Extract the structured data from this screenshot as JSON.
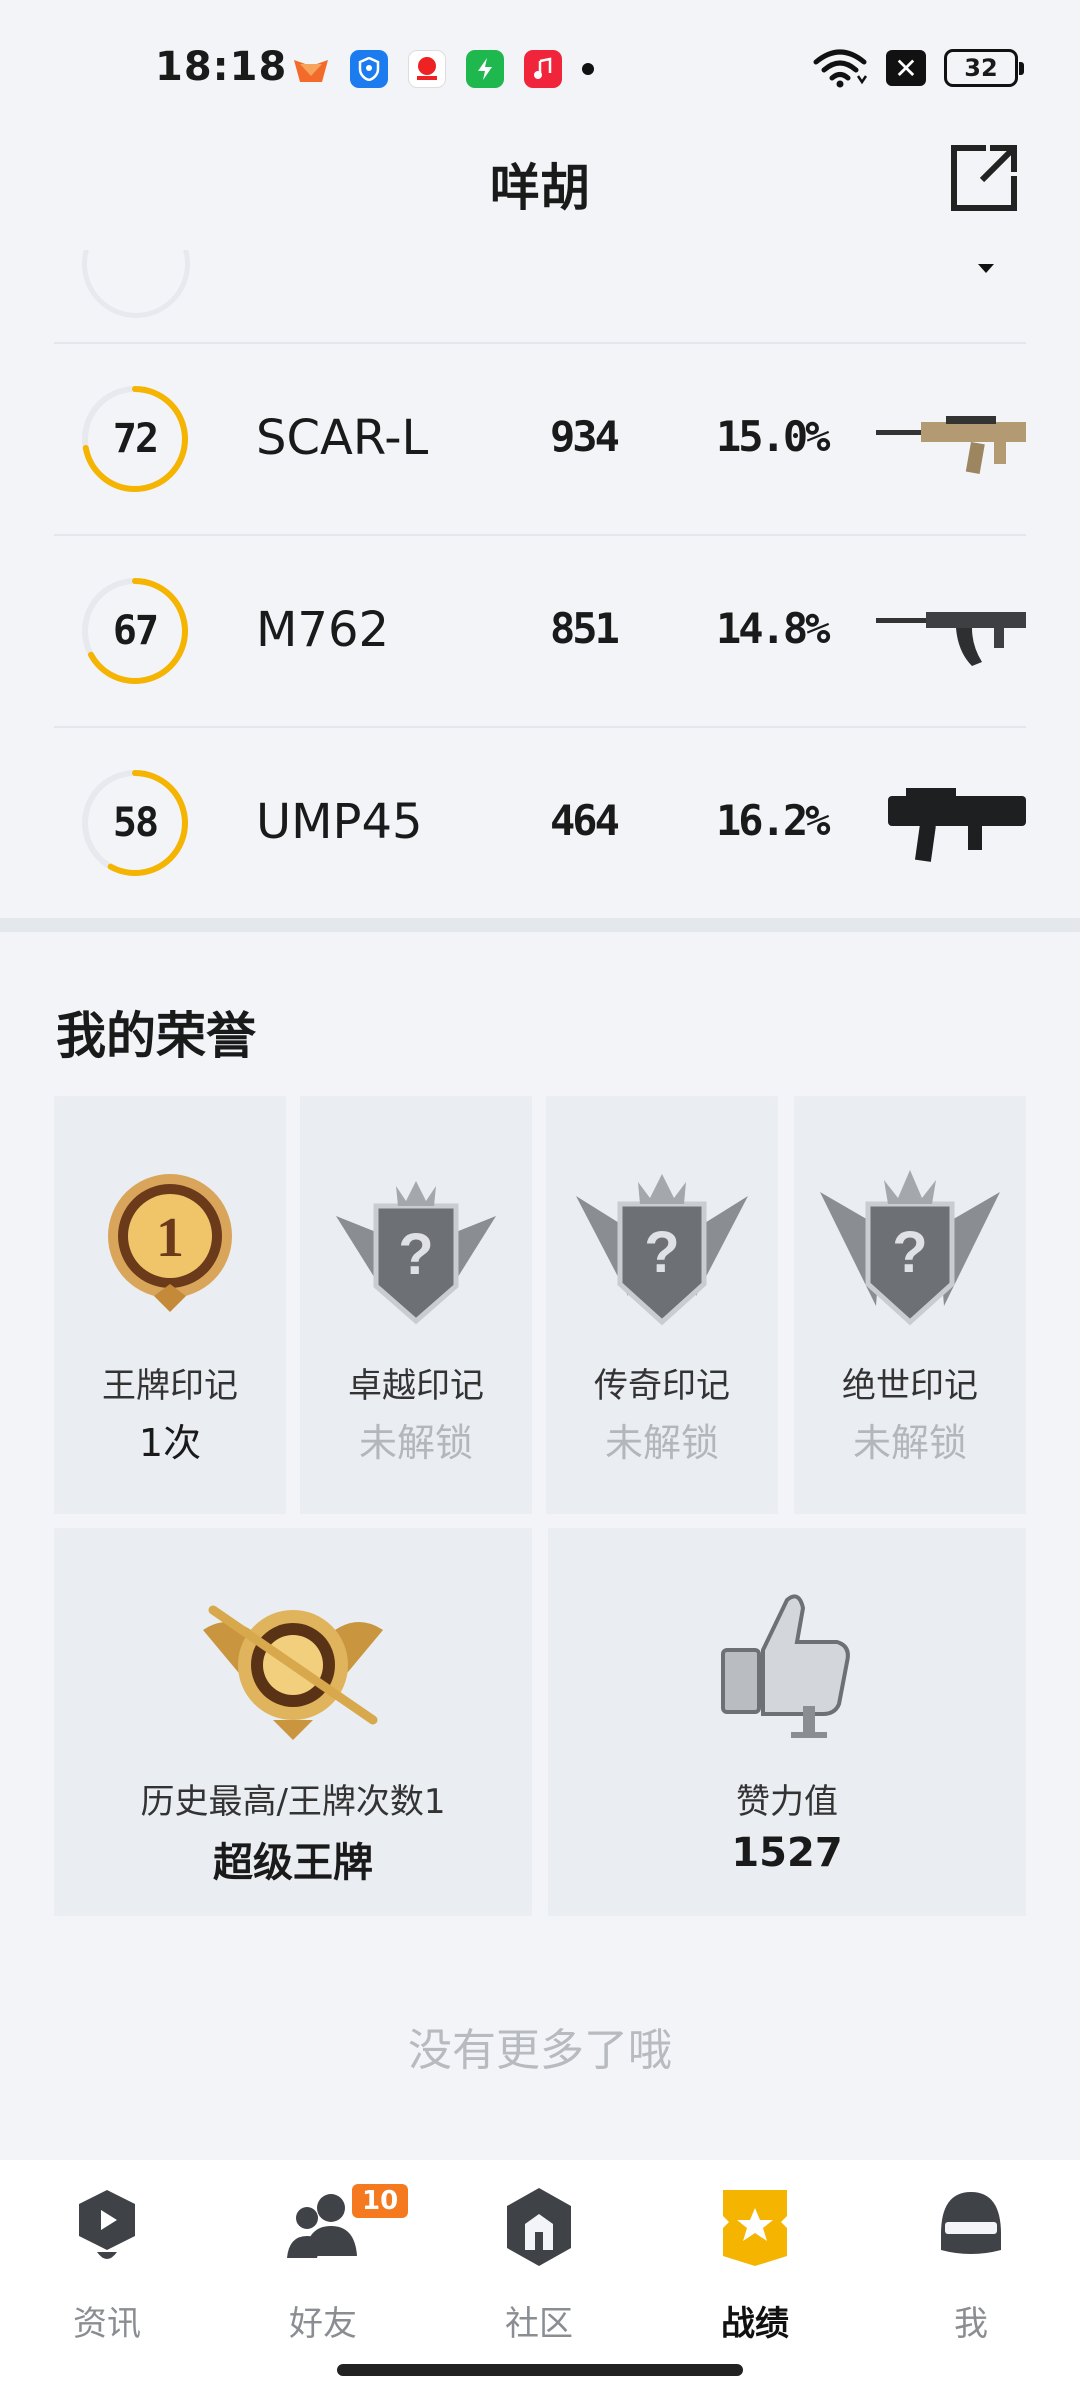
{
  "status_bar": {
    "time": "18:18",
    "notification_icons": [
      "fan-app-icon",
      "shield-app-icon",
      "red-app-icon",
      "green-app-icon",
      "music-app-icon"
    ],
    "battery": "32"
  },
  "header": {
    "title": "咩胡"
  },
  "weapons": [
    {
      "score": 72,
      "name": "SCAR-L",
      "kills": "934",
      "rate": "15.0%"
    },
    {
      "score": 67,
      "name": "M762",
      "kills": "851",
      "rate": "14.8%"
    },
    {
      "score": 58,
      "name": "UMP45",
      "kills": "464",
      "rate": "16.2%"
    }
  ],
  "honors": {
    "title": "我的荣誉",
    "cards": [
      {
        "name": "王牌印记",
        "value": "1次",
        "locked": false
      },
      {
        "name": "卓越印记",
        "value": "未解锁",
        "locked": true
      },
      {
        "name": "传奇印记",
        "value": "未解锁",
        "locked": true
      },
      {
        "name": "绝世印记",
        "value": "未解锁",
        "locked": true
      }
    ],
    "highest": {
      "label": "历史最高/王牌次数1",
      "value": "超级王牌"
    },
    "likes": {
      "label": "赞力值",
      "value": "1527"
    }
  },
  "footer_text": "没有更多了哦",
  "nav": [
    {
      "label": "资讯",
      "icon": "news-icon",
      "active": false
    },
    {
      "label": "好友",
      "icon": "friends-icon",
      "active": false,
      "badge": "10"
    },
    {
      "label": "社区",
      "icon": "community-icon",
      "active": false
    },
    {
      "label": "战绩",
      "icon": "record-icon",
      "active": true
    },
    {
      "label": "我",
      "icon": "helmet-icon",
      "active": false
    }
  ],
  "colors": {
    "accent": "#f5b400",
    "badge": "#f4791f",
    "background": "#f2f4f8"
  }
}
